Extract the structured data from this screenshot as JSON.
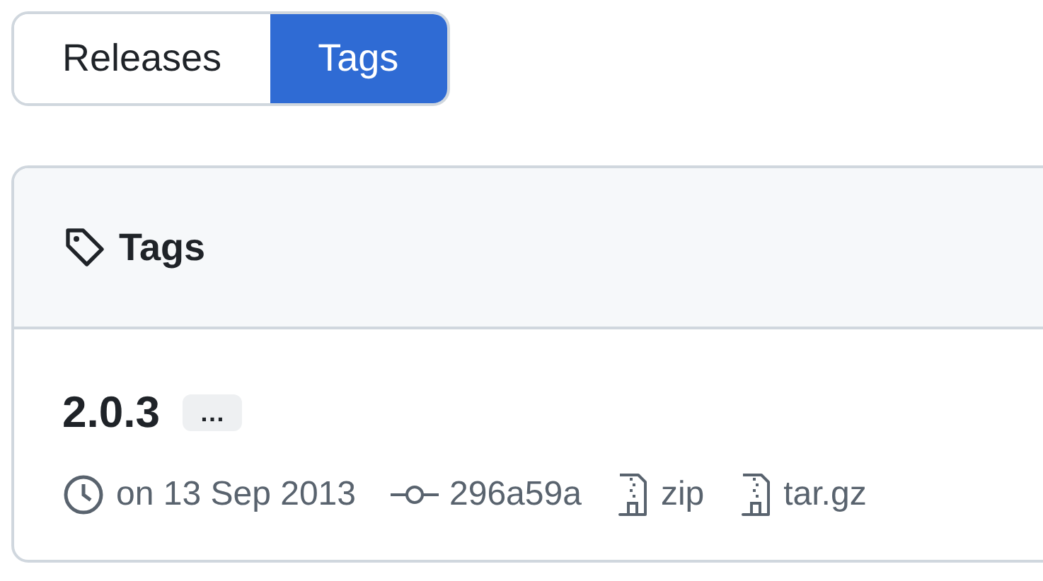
{
  "tabs": [
    {
      "label": "Releases",
      "selected": false
    },
    {
      "label": "Tags",
      "selected": true
    }
  ],
  "box": {
    "title": "Tags"
  },
  "tags": [
    {
      "name": "2.0.3",
      "more": "…",
      "date": "on 13 Sep 2013",
      "commit": "296a59a",
      "downloads": [
        "zip",
        "tar.gz"
      ]
    }
  ]
}
